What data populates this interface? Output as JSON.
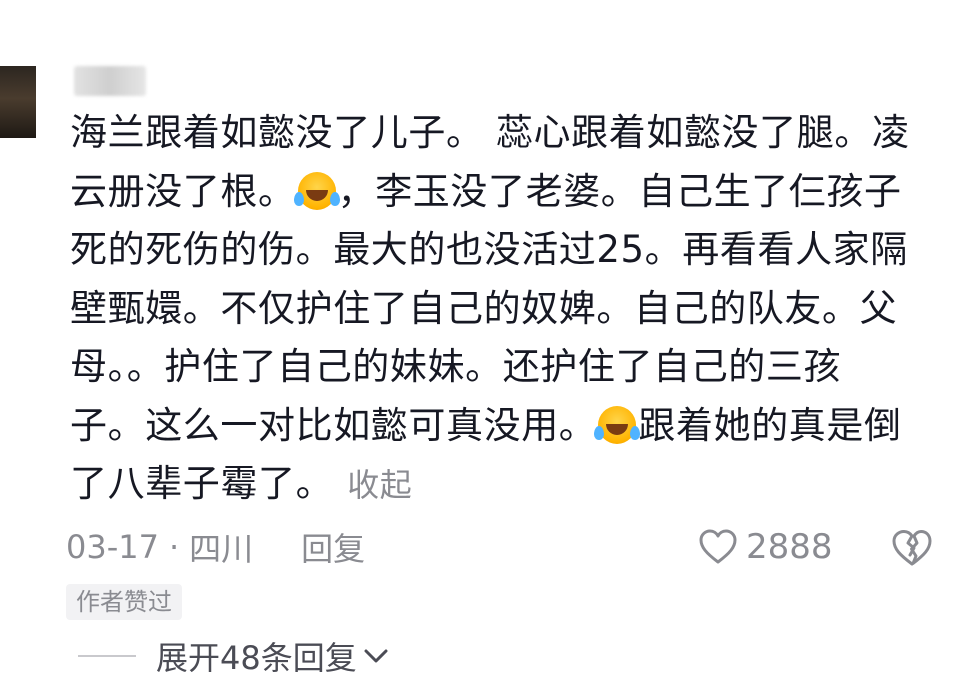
{
  "comment": {
    "lines": [
      "海兰跟着如懿没了儿子。 蕊心跟着如懿没了腿。凌",
      "云册没了根。",
      "，李玉没了老婆。自己生了仨孩子",
      "死的死伤的伤。最大的也没活过25。再看看人家隔",
      "壁甄嬛。不仅护住了自己的奴婢。自己的队友。父",
      "母。。护住了自己的妹妹。还护住了自己的三孩",
      "子。这么一对比如懿可真没用。",
      "跟着她的真是倒",
      "了八辈子霉了。"
    ],
    "collapse_label": "收起",
    "emoji_name": "laughing-crying-emoji"
  },
  "meta": {
    "date": "03-17",
    "separator": "·",
    "location": "四川",
    "reply_label": "回复"
  },
  "likes": {
    "count": "2888"
  },
  "author_badge": "作者赞过",
  "expand": {
    "label": "展开48条回复"
  },
  "colors": {
    "text": "#161823",
    "secondary": "#8a8b91",
    "badge_bg": "#f2f2f4"
  }
}
